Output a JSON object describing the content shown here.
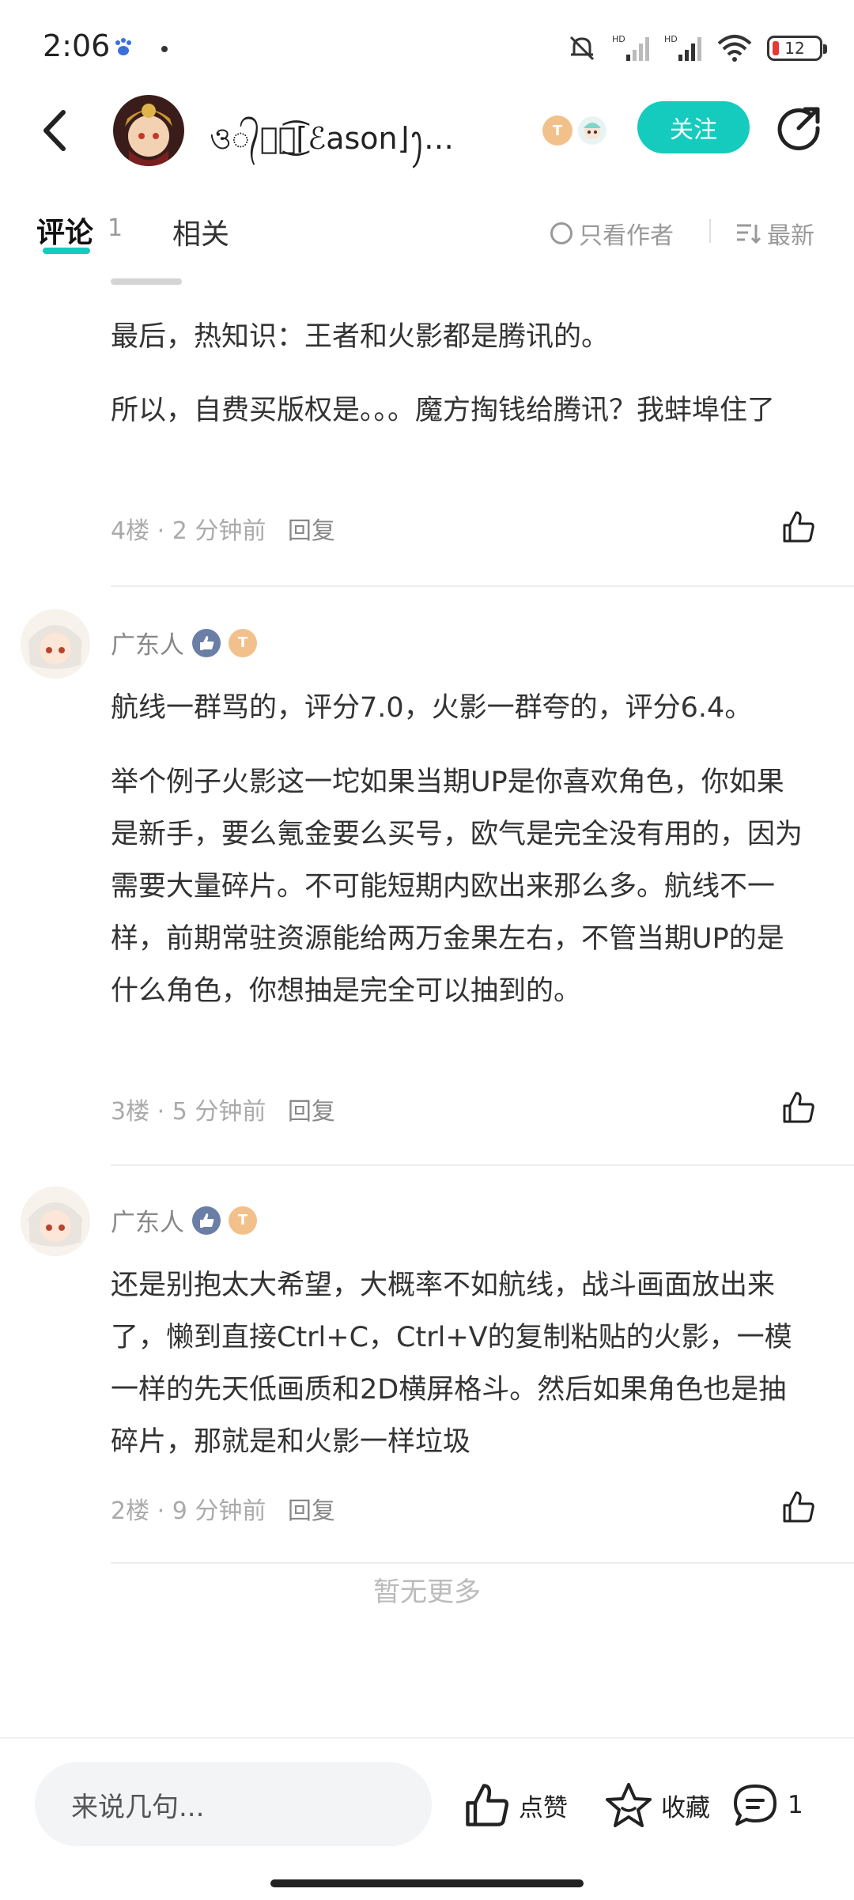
{
  "status_bar": {
    "time": "2:06",
    "battery": "12",
    "signal_label_1": "HD",
    "signal_label_2": "HD"
  },
  "nav": {
    "author_name": "ও᭄ঔৣ͜͡⌈ℰason⌋ꫂ…",
    "follow_label": "关注",
    "medal_text": "T"
  },
  "tabs": {
    "comments_label": "评论",
    "comments_count": "1",
    "related_label": "相关",
    "only_author_label": "只看作者",
    "sort_label": "最新"
  },
  "comments": [
    {
      "paragraphs": [
        "最后，热知识：王者和火影都是腾讯的。",
        "所以，自费买版权是。。。魔方掏钱给腾讯？我蚌埠住了"
      ],
      "floor": "4楼",
      "time": "2 分钟前",
      "reply": "回复"
    },
    {
      "user": "广东人",
      "paragraphs": [
        "航线一群骂的，评分7.0，火影一群夸的，评分6.4。",
        "举个例子火影这一坨如果当期UP是你喜欢角色，你如果是新手，要么氪金要么买号，欧气是完全没有用的，因为需要大量碎片。不可能短期内欧出来那么多。航线不一样，前期常驻资源能给两万金果左右，不管当期UP的是什么角色，你想抽是完全可以抽到的。"
      ],
      "floor": "3楼",
      "time": "5 分钟前",
      "reply": "回复"
    },
    {
      "user": "广东人",
      "paragraphs": [
        "还是别抱太大希望，大概率不如航线，战斗画面放出来了，懒到直接Ctrl+C，Ctrl+V的复制粘贴的火影，一模一样的先天低画质和2D横屏格斗。然后如果角色也是抽碎片，那就是和火影一样垃圾"
      ],
      "floor": "2楼",
      "time": "9 分钟前",
      "reply": "回复"
    }
  ],
  "no_more": "暂无更多",
  "bottom_bar": {
    "input_placeholder": "来说几句...",
    "like_label": "点赞",
    "favorite_label": "收藏",
    "comment_count": "1"
  },
  "colors": {
    "accent": "#15cbbd",
    "text_primary": "#333333",
    "text_secondary": "#aaaaaa"
  }
}
